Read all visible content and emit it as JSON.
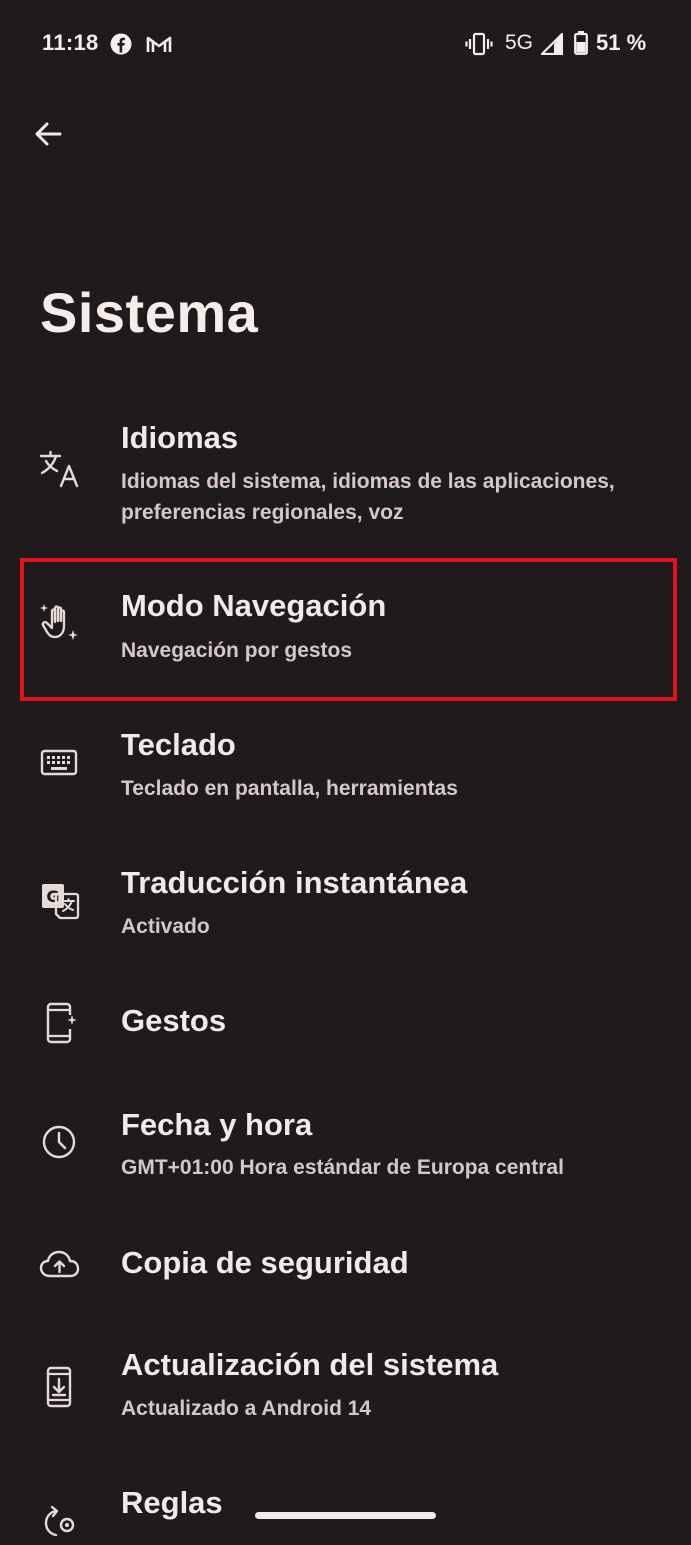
{
  "status_bar": {
    "time": "11:18",
    "network": "5G",
    "battery": "51 %",
    "notification_icons": [
      "facebook-icon",
      "gmail-icon"
    ],
    "system_icons": [
      "vibrate-icon",
      "signal-icon",
      "battery-icon"
    ]
  },
  "header": {
    "back_icon": "arrow-left-icon",
    "title": "Sistema"
  },
  "items": [
    {
      "icon": "translate-icon",
      "title": "Idiomas",
      "summary": "Idiomas del sistema, idiomas de las aplicaciones, preferencias regionales, voz"
    },
    {
      "icon": "gesture-hand-icon",
      "title": "Modo Navegación",
      "summary": "Navegación por gestos",
      "highlighted": true,
      "highlight_color": "#e0121a"
    },
    {
      "icon": "keyboard-icon",
      "title": "Teclado",
      "summary": "Teclado en pantalla, herramientas"
    },
    {
      "icon": "live-translate-icon",
      "title": "Traducción instantánea",
      "summary": "Activado"
    },
    {
      "icon": "phone-gesture-icon",
      "title": "Gestos",
      "summary": ""
    },
    {
      "icon": "clock-icon",
      "title": "Fecha y hora",
      "summary": "GMT+01:00 Hora estándar de Europa central"
    },
    {
      "icon": "cloud-upload-icon",
      "title": "Copia de seguridad",
      "summary": ""
    },
    {
      "icon": "system-update-icon",
      "title": "Actualización del sistema",
      "summary": "Actualizado a Android 14"
    },
    {
      "icon": "rules-icon",
      "title": "Reglas",
      "summary": ""
    }
  ],
  "colors": {
    "background": "#1f1a1b",
    "text_primary": "#f4e9e9",
    "text_secondary": "#d6c7c7",
    "highlight": "#e0121a"
  }
}
